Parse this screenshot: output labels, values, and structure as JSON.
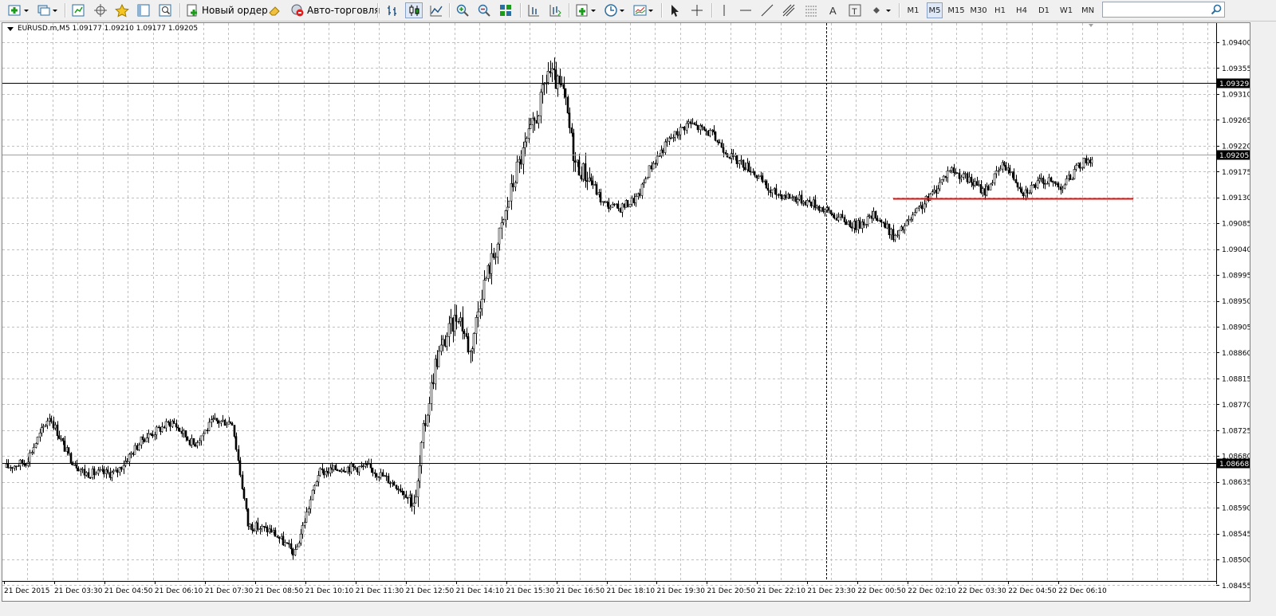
{
  "toolbar": {
    "new_order_label": "Новый ордер",
    "autotrading_label": "Авто-торговля",
    "timeframes": [
      "M1",
      "M5",
      "M15",
      "M30",
      "H1",
      "H4",
      "D1",
      "W1",
      "MN"
    ],
    "active_timeframe": "M5",
    "search_placeholder": ""
  },
  "chart": {
    "symbol_info": "EURUSD.m,M5  1.09177 1.09210 1.09177 1.09205",
    "price_ticks": [
      "1.09400",
      "1.09355",
      "1.09310",
      "1.09265",
      "1.09220",
      "1.09175",
      "1.09130",
      "1.09085",
      "1.09040",
      "1.08995",
      "1.08950",
      "1.08905",
      "1.08860",
      "1.08815",
      "1.08770",
      "1.08725",
      "1.08680",
      "1.08635",
      "1.08590",
      "1.08545",
      "1.08500",
      "1.08455"
    ],
    "price_tick_values": [
      1.094,
      1.09355,
      1.0931,
      1.09265,
      1.0922,
      1.09175,
      1.0913,
      1.09085,
      1.0904,
      1.08995,
      1.0895,
      1.08905,
      1.0886,
      1.08815,
      1.0877,
      1.08725,
      1.0868,
      1.08635,
      1.0859,
      1.08545,
      1.085,
      1.08455
    ],
    "time_labels": [
      "21 Dec 2015",
      "21 Dec 03:30",
      "21 Dec 04:50",
      "21 Dec 06:10",
      "21 Dec 07:30",
      "21 Dec 08:50",
      "21 Dec 10:10",
      "21 Dec 11:30",
      "21 Dec 12:50",
      "21 Dec 14:10",
      "21 Dec 15:30",
      "21 Dec 16:50",
      "21 Dec 18:10",
      "21 Dec 19:30",
      "21 Dec 20:50",
      "21 Dec 22:10",
      "21 Dec 23:30",
      "22 Dec 00:50",
      "22 Dec 02:10",
      "22 Dec 03:30",
      "22 Dec 04:50",
      "22 Dec 06:10"
    ],
    "hlines": [
      {
        "price": 1.09329,
        "label": "1.09329",
        "color": "#000000"
      },
      {
        "price": 1.08668,
        "label": "1.08668",
        "color": "#000000"
      }
    ],
    "current_price": {
      "price": 1.09205,
      "label": "1.09205"
    },
    "support_line": {
      "price": 1.09128,
      "color": "#e01010"
    },
    "vertical_marker_index": 16,
    "colors": {
      "candle": "#000000",
      "grid": "#c0c0c0",
      "price_label_bg": "#000000"
    }
  }
}
